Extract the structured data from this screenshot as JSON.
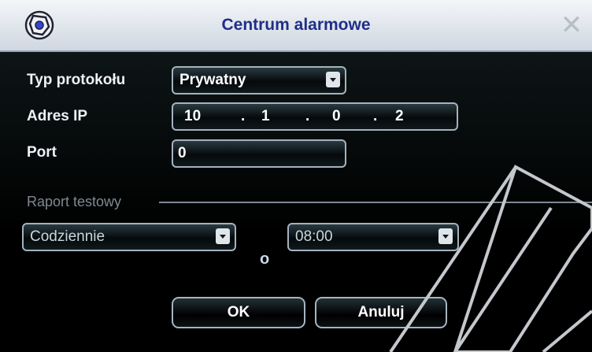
{
  "dialog": {
    "title": "Centrum alarmowe",
    "title_icon": "settings-ball-icon",
    "close_icon": "close-icon"
  },
  "form": {
    "protocol_label": "Typ protokołu",
    "protocol_value": "Prywatny",
    "ip_label": "Adres IP",
    "ip_octets": [
      "10",
      "1",
      "0",
      "2"
    ],
    "port_label": "Port",
    "port_value": "0"
  },
  "test_report": {
    "section_label": "Raport testowy",
    "frequency_value": "Codziennie",
    "o_label": "o",
    "time_value": "08:00"
  },
  "buttons": {
    "ok": "OK",
    "cancel": "Anuluj"
  },
  "colors": {
    "title_text": "#1f2f86",
    "panel_bg": "#000000",
    "field_border": "#a4b2bf"
  }
}
